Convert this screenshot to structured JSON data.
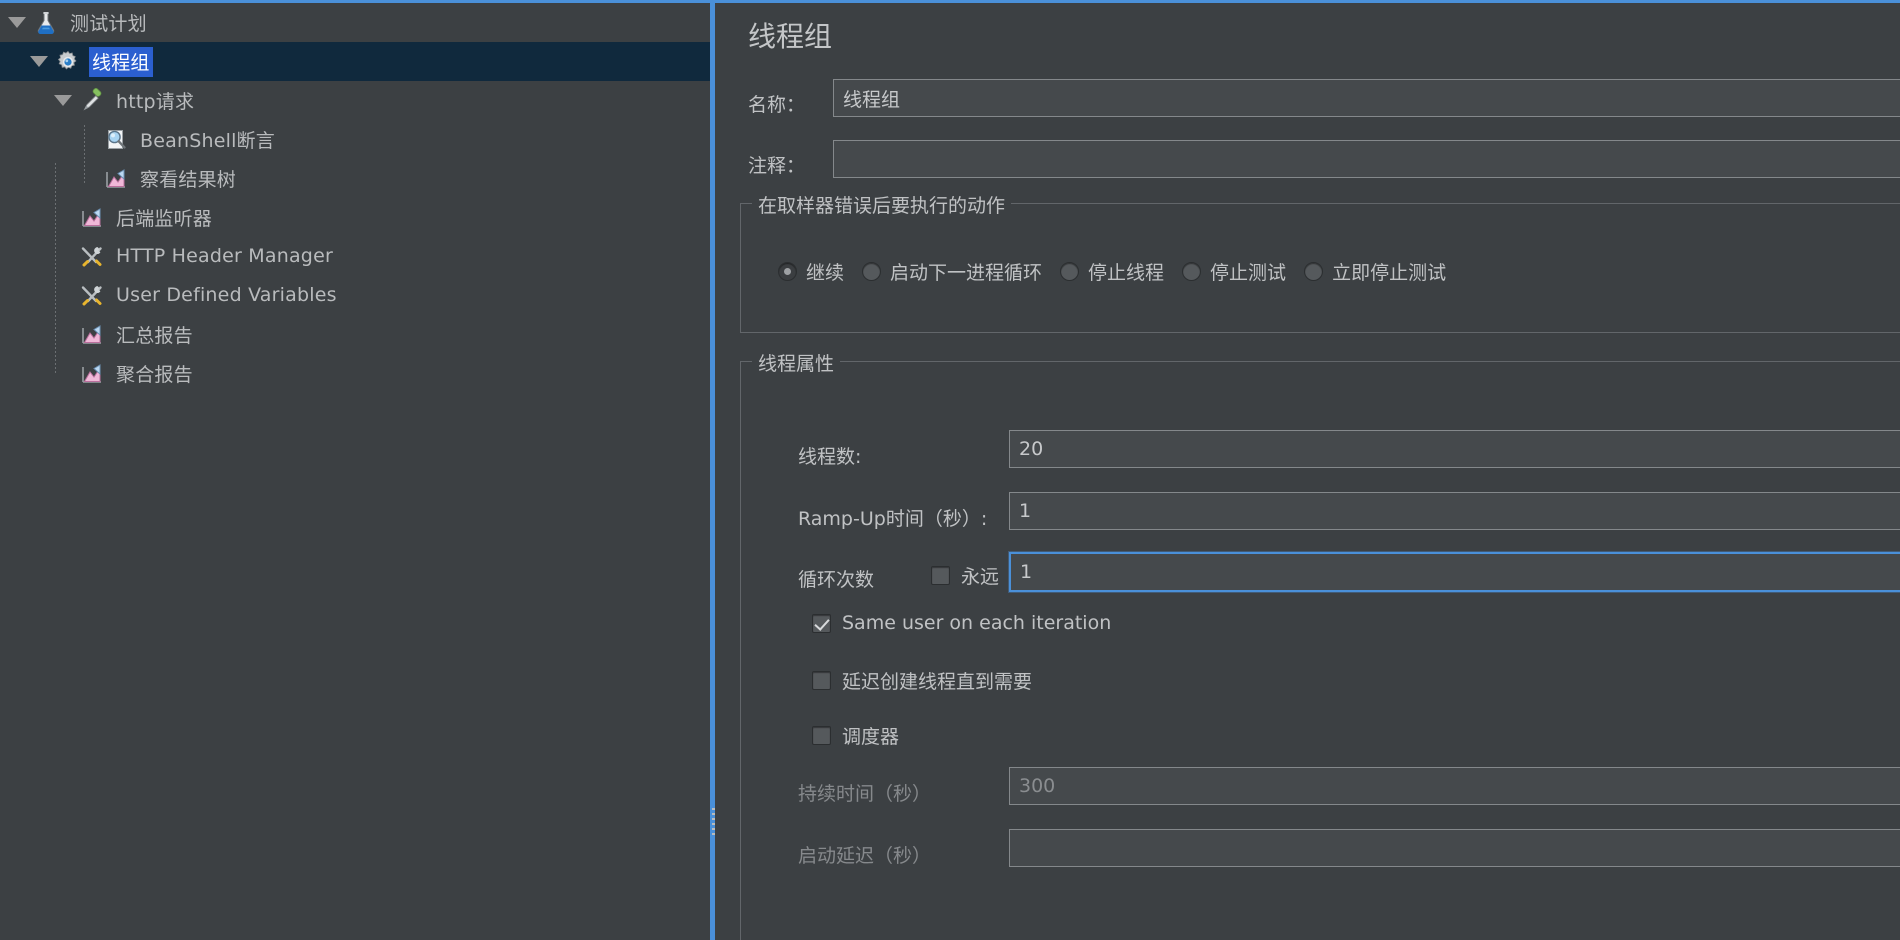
{
  "colors": {
    "window_bg": "#3c4043",
    "accent_blue": "#4a90d9",
    "selection_bg": "#10293d",
    "selection_label_bg": "#2b5fd0",
    "field_bg": "#45494c",
    "text": "#c0c2c4",
    "text_disabled": "#86898c"
  },
  "tree": {
    "items": [
      {
        "label": "测试计划",
        "icon": "flask-icon",
        "depth": 0,
        "expanded": true,
        "selected": false
      },
      {
        "label": "线程组",
        "icon": "gear-icon",
        "depth": 1,
        "expanded": true,
        "selected": true
      },
      {
        "label": "http请求",
        "icon": "pipette-icon",
        "depth": 2,
        "expanded": true,
        "selected": false
      },
      {
        "label": "BeanShell断言",
        "icon": "magnifier-document-icon",
        "depth": 3,
        "expanded": null,
        "selected": false
      },
      {
        "label": "察看结果树",
        "icon": "chart-icon",
        "depth": 3,
        "expanded": null,
        "selected": false
      },
      {
        "label": "后端监听器",
        "icon": "chart-icon",
        "depth": 2,
        "expanded": null,
        "selected": false
      },
      {
        "label": "HTTP Header Manager",
        "icon": "tools-icon",
        "depth": 2,
        "expanded": null,
        "selected": false
      },
      {
        "label": "User Defined Variables",
        "icon": "tools-icon",
        "depth": 2,
        "expanded": null,
        "selected": false
      },
      {
        "label": "汇总报告",
        "icon": "chart-icon",
        "depth": 2,
        "expanded": null,
        "selected": false
      },
      {
        "label": "聚合报告",
        "icon": "chart-icon",
        "depth": 2,
        "expanded": null,
        "selected": false
      }
    ]
  },
  "panel": {
    "title": "线程组",
    "name_label": "名称：",
    "name_value": "线程组",
    "comment_label": "注释：",
    "comment_value": "",
    "comment_placeholder": ""
  },
  "error_action": {
    "group_title": "在取样器错误后要执行的动作",
    "options": [
      {
        "label": "继续",
        "selected": true
      },
      {
        "label": "启动下一进程循环",
        "selected": false
      },
      {
        "label": "停止线程",
        "selected": false
      },
      {
        "label": "停止测试",
        "selected": false
      },
      {
        "label": "立即停止测试",
        "selected": false
      }
    ]
  },
  "thread_properties": {
    "group_title": "线程属性",
    "threads_label": "线程数:",
    "threads_value": "20",
    "rampup_label": "Ramp-Up时间（秒）:",
    "rampup_value": "1",
    "loops_label": "循环次数",
    "forever_label": "永远",
    "forever_checked": false,
    "loops_value": "1",
    "loops_focused": true,
    "same_user_label": "Same user on each iteration",
    "same_user_checked": true,
    "delayed_start_label": "延迟创建线程直到需要",
    "delayed_start_checked": false,
    "scheduler_label": "调度器",
    "scheduler_checked": false,
    "duration_label": "持续时间（秒）",
    "duration_value": "300",
    "duration_disabled": true,
    "startup_delay_label": "启动延迟（秒）",
    "startup_delay_value": "",
    "startup_delay_disabled": true
  }
}
